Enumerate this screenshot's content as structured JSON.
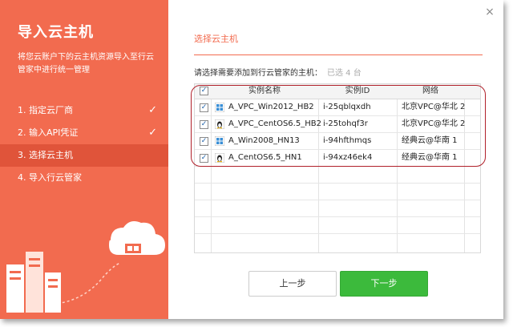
{
  "sidebar": {
    "title": "导入云主机",
    "description": "将您云账户下的云主机资源导入至行云管家中进行统一管理",
    "steps": [
      {
        "label": "1. 指定云厂商",
        "done": true
      },
      {
        "label": "2. 输入API凭证",
        "done": true
      },
      {
        "label": "3. 选择云主机",
        "done": false
      },
      {
        "label": "4. 导入行云管家",
        "done": false
      }
    ],
    "check_glyph": "✓"
  },
  "main": {
    "close_glyph": "×",
    "section_title": "选择云主机",
    "prompt": "请选择需要添加到行云管家的主机：",
    "selected_count": "已选 4 台",
    "table": {
      "headers": [
        "实例名称",
        "实例ID",
        "网络"
      ],
      "rows": [
        {
          "name": "A_VPC_Win2012_HB2",
          "id": "i-25qblqxdh",
          "network": "北京VPC@华北 2",
          "os": "windows-icon",
          "checked": true
        },
        {
          "name": "A_VPC_CentOS6.5_HB2",
          "id": "i-25tohqf3r",
          "network": "北京VPC@华北 2",
          "os": "linux-icon",
          "checked": true
        },
        {
          "name": "A_Win2008_HN13",
          "id": "i-94hfthmqs",
          "network": "经典云@华南 1",
          "os": "windows-icon",
          "checked": true
        },
        {
          "name": "A_CentOS6.5_HN1",
          "id": "i-94xz46ek4",
          "network": "经典云@华南 1",
          "os": "linux-icon",
          "checked": true
        }
      ]
    },
    "buttons": {
      "prev": "上一步",
      "next": "下一步"
    }
  },
  "colors": {
    "accent": "#f26b4f",
    "next_button": "#3cba3c",
    "highlight": "#b0202a"
  }
}
